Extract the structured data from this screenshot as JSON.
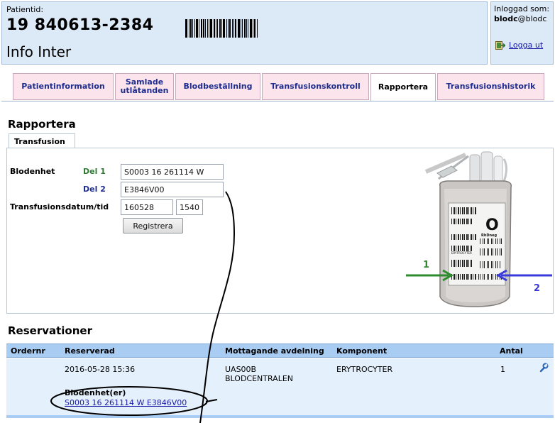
{
  "header": {
    "patient_id_label": "Patientid:",
    "patient_id": "19 840613-2384",
    "patient_name": "Info Inter",
    "login_label": "Inloggad som:",
    "login_user_bold": "blodc",
    "login_user_rest": "@blodc",
    "logout_label": "Logga ut"
  },
  "tabs": [
    {
      "label": "Patientinformation"
    },
    {
      "label": "Samlade utlåtanden"
    },
    {
      "label": "Blodbeställning"
    },
    {
      "label": "Transfusionskontroll"
    },
    {
      "label": "Rapportera"
    },
    {
      "label": "Transfusionshistorik"
    }
  ],
  "rapportera": {
    "title": "Rapportera",
    "subtab": "Transfusion",
    "blodenhet_label": "Blodenhet",
    "del1_label": "Del 1",
    "del1_value": "S0003 16 261114 W",
    "del2_label": "Del 2",
    "del2_value": "E3846V00",
    "datetime_label": "Transfusionsdatum/tid",
    "date_value": "160528",
    "time_value": "1540",
    "register_button": "Registrera",
    "bag": {
      "blood_group": "O",
      "rh": "RhDneg",
      "component": "ERYTROCYTER",
      "arrow1_label": "1",
      "arrow2_label": "2",
      "arrow1_color": "#2e8b2e",
      "arrow2_color": "#3b3bdb"
    }
  },
  "reservationer": {
    "title": "Reservationer",
    "columns": {
      "ordernr": "Ordernr",
      "reserverad": "Reserverad",
      "avdelning": "Mottagande avdelning",
      "komponent": "Komponent",
      "antal": "Antal"
    },
    "row": {
      "ordernr": "",
      "reserverad": "2016-05-28 15:36",
      "avdelning_line1": "UAS00B",
      "avdelning_line2": "BLODCENTRALEN",
      "komponent": "ERYTROCYTER",
      "antal": "1",
      "blodenhet_label": "Blodenhet(er)",
      "blodenhet_link": "S0003 16 261114 W E3846V00"
    }
  },
  "colors": {
    "header_bg": "#dce9f7",
    "tab_bg": "#fce4ec",
    "tab_text": "#1f2d8f",
    "table_header_bg": "#a8ccf2",
    "row_bg": "#e4f0fb"
  }
}
